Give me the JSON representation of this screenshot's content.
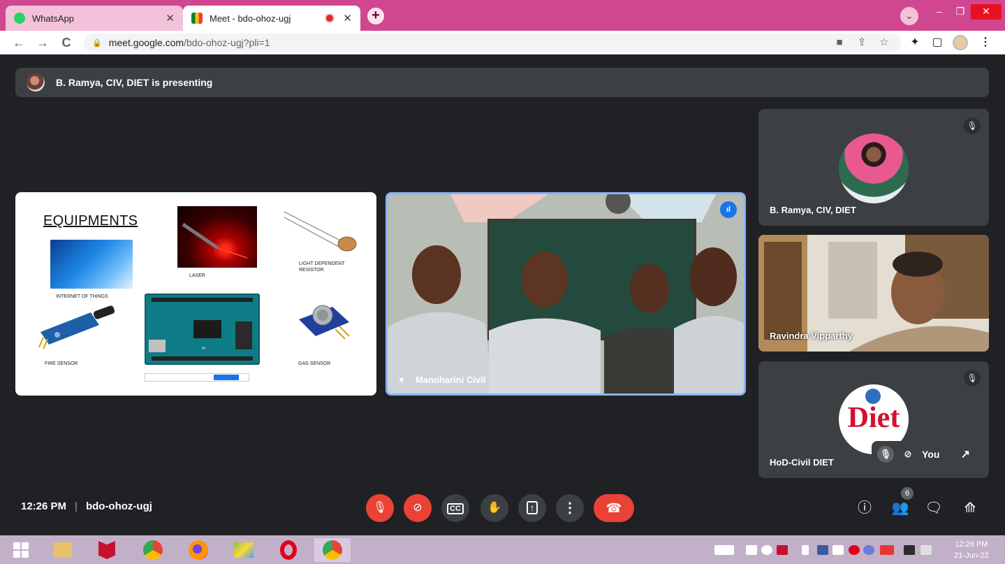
{
  "browser": {
    "tabs": [
      {
        "title": "WhatsApp",
        "icon": "whatsapp-icon",
        "active": false
      },
      {
        "title": "Meet - bdo-ohoz-ugj",
        "icon": "google-meet-icon",
        "active": true,
        "recording": true
      }
    ],
    "close_glyph": "✕",
    "new_tab_glyph": "+",
    "url_domain": "meet.google.com",
    "url_path": "/bdo-ohoz-ugj?pli=1",
    "accent_color": "#d1478f"
  },
  "meeting": {
    "presenting_text": "B. Ramya, CIV, DIET is presenting",
    "time": "12:26 PM",
    "separator": "|",
    "code": "bdo-ohoz-ugj",
    "people_count": "6"
  },
  "slide": {
    "heading": "EQUIPMENTS",
    "captions": {
      "laser": "LASER",
      "ldr": "LIGHT DEPENDENT RESISTOR",
      "iot": "INTERNET OF THINGS",
      "fire": "FIRE SENSOR",
      "gas": "GAS SENSOR"
    }
  },
  "participants": {
    "center": {
      "name": "Manoharini Civil"
    },
    "side": [
      {
        "name": "B. Ramya, CIV, DIET"
      },
      {
        "name": "Ravindra Vipparthy"
      },
      {
        "name": "HoD-Civil DIET",
        "logo_text": "Diet"
      }
    ],
    "self_label": "You"
  },
  "taskbar": {
    "time": "12:26 PM",
    "date": "21-Jun-22"
  },
  "colors": {
    "meet_bg": "#202124",
    "tile_bg": "#3c4043",
    "danger": "#ea4335",
    "speaking_border": "#8ab4f8"
  }
}
